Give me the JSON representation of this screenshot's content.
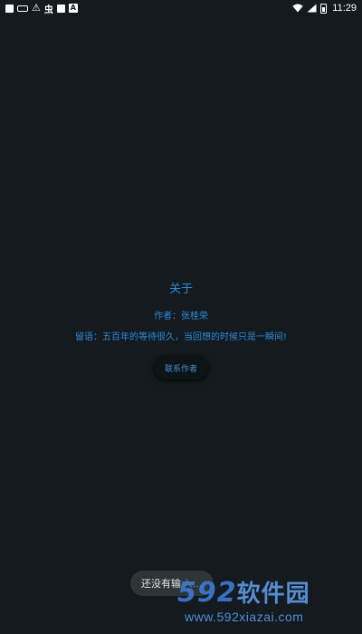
{
  "status_bar": {
    "time": "11:29",
    "left_icons": [
      "square-icon",
      "usb-icon",
      "warning-icon",
      "bug-icon",
      "square-icon",
      "a-box-icon"
    ],
    "right_icons": [
      "wifi-icon",
      "signal-icon",
      "battery-icon"
    ],
    "bug_glyph": "虫",
    "a_glyph": "A",
    "warn_glyph": "⚠"
  },
  "about": {
    "title": "关于",
    "author": "作者：张桂荣",
    "message": "留语：五百年的等待很久，当回想的时候只是一瞬间!",
    "contact_button": "联系作者"
  },
  "toast": {
    "text": "还没有输",
    "action": "入..."
  },
  "watermark": {
    "logo_num": "592",
    "logo_text": "软件园",
    "url": "www.592xiazai.com"
  },
  "colors": {
    "background": "#141a1d",
    "accent": "#2a8be0",
    "toast_bg": "#2f3436"
  }
}
